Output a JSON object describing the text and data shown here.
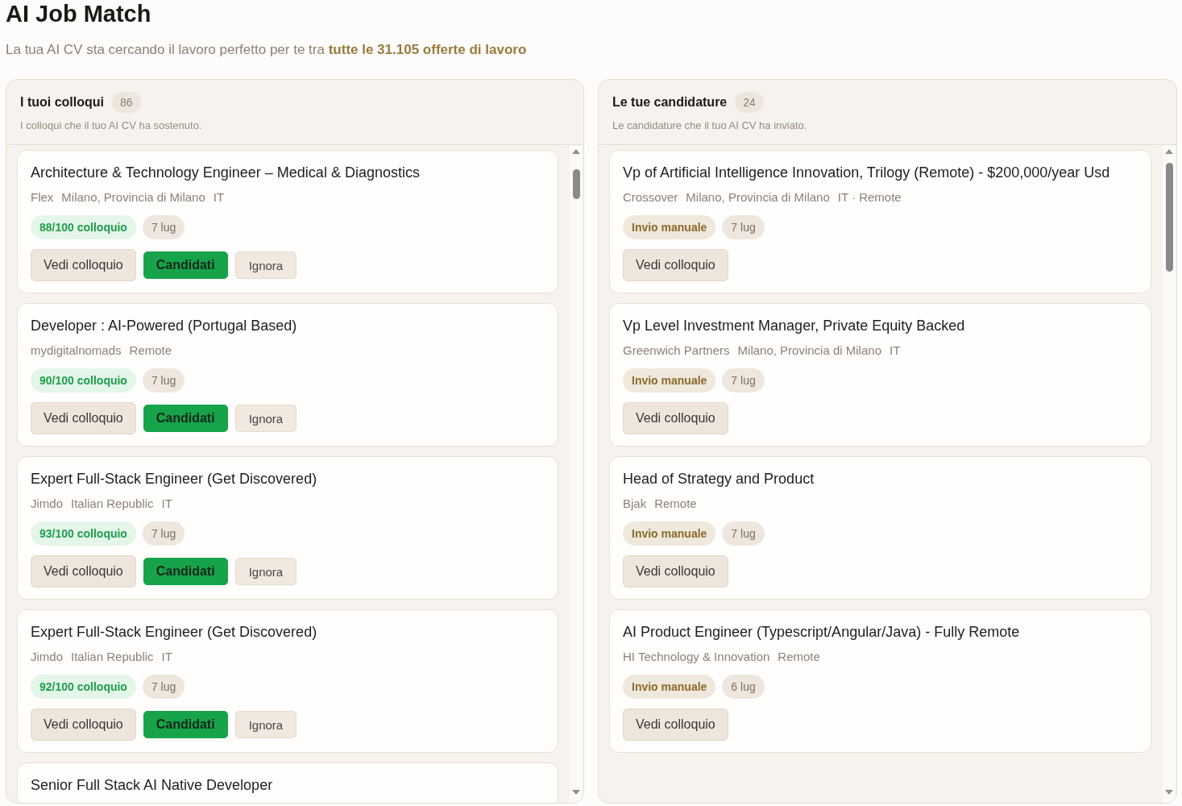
{
  "page": {
    "title": "AI Job Match",
    "subtitle": "La tua AI CV sta cercando il lavoro perfetto per te tra **tutte le 31.105 offerte di lavoro**"
  },
  "panels": [
    {
      "title": "I tuoi colloqui",
      "count": "86",
      "description": "I colloqui che il tuo AI CV ha sostenuto.",
      "cards": [
        {
          "title": "Architecture & Technology Engineer – Medical & Diagnostics",
          "meta": [
            "Flex",
            "Milano, Provincia di Milano",
            "IT"
          ],
          "tags": [
            {
              "kind": "score",
              "label": "88/100 colloquio"
            },
            {
              "kind": "date",
              "label": "7 lug"
            }
          ],
          "buttons": [
            {
              "kind": "view",
              "label": "Vedi colloquio"
            },
            {
              "kind": "apply",
              "label": "Candidati"
            },
            {
              "kind": "ignore",
              "label": "Ignora"
            }
          ]
        },
        {
          "title": "Developer : AI-Powered (Portugal Based)",
          "meta": [
            "mydigitalnomads",
            "Remote"
          ],
          "tags": [
            {
              "kind": "score",
              "label": "90/100 colloquio"
            },
            {
              "kind": "date",
              "label": "7 lug"
            }
          ],
          "buttons": [
            {
              "kind": "view",
              "label": "Vedi colloquio"
            },
            {
              "kind": "apply",
              "label": "Candidati"
            },
            {
              "kind": "ignore",
              "label": "Ignora"
            }
          ]
        },
        {
          "title": "Expert Full-Stack Engineer (Get Discovered)",
          "meta": [
            "Jimdo",
            "Italian Republic",
            "IT"
          ],
          "tags": [
            {
              "kind": "score",
              "label": "93/100 colloquio"
            },
            {
              "kind": "date",
              "label": "7 lug"
            }
          ],
          "buttons": [
            {
              "kind": "view",
              "label": "Vedi colloquio"
            },
            {
              "kind": "apply",
              "label": "Candidati"
            },
            {
              "kind": "ignore",
              "label": "Ignora"
            }
          ]
        },
        {
          "title": "Expert Full-Stack Engineer (Get Discovered)",
          "meta": [
            "Jimdo",
            "Italian Republic",
            "IT"
          ],
          "tags": [
            {
              "kind": "score",
              "label": "92/100 colloquio"
            },
            {
              "kind": "date",
              "label": "7 lug"
            }
          ],
          "buttons": [
            {
              "kind": "view",
              "label": "Vedi colloquio"
            },
            {
              "kind": "apply",
              "label": "Candidati"
            },
            {
              "kind": "ignore",
              "label": "Ignora"
            }
          ]
        },
        {
          "title": "Senior Full Stack AI Native Developer"
        }
      ]
    },
    {
      "title": "Le tue candidature",
      "count": "24",
      "description": "Le candidature che il tuo AI CV ha inviato.",
      "cards": [
        {
          "title": "Vp of Artificial Intelligence Innovation, Trilogy (Remote) - $200,000/year Usd",
          "meta": [
            "Crossover",
            "Milano, Provincia di Milano",
            "IT · Remote"
          ],
          "tags": [
            {
              "kind": "manual",
              "label": "Invio manuale"
            },
            {
              "kind": "date",
              "label": "7 lug"
            }
          ],
          "buttons": [
            {
              "kind": "view",
              "label": "Vedi colloquio"
            }
          ]
        },
        {
          "title": "Vp Level Investment Manager, Private Equity Backed",
          "meta": [
            "Greenwich Partners",
            "Milano, Provincia di Milano",
            "IT"
          ],
          "tags": [
            {
              "kind": "manual",
              "label": "Invio manuale"
            },
            {
              "kind": "date",
              "label": "7 lug"
            }
          ],
          "buttons": [
            {
              "kind": "view",
              "label": "Vedi colloquio"
            }
          ]
        },
        {
          "title": "Head of Strategy and Product",
          "meta": [
            "Bjak",
            "Remote"
          ],
          "tags": [
            {
              "kind": "manual",
              "label": "Invio manuale"
            },
            {
              "kind": "date",
              "label": "7 lug"
            }
          ],
          "buttons": [
            {
              "kind": "view",
              "label": "Vedi colloquio"
            }
          ]
        },
        {
          "title": "AI Product Engineer (Typescript/Angular/Java) - Fully Remote",
          "meta": [
            "HI Technology & Innovation",
            "Remote"
          ],
          "tags": [
            {
              "kind": "manual",
              "label": "Invio manuale"
            },
            {
              "kind": "date",
              "label": "6 lug"
            }
          ],
          "buttons": [
            {
              "kind": "view",
              "label": "Vedi colloquio"
            }
          ]
        }
      ]
    }
  ]
}
